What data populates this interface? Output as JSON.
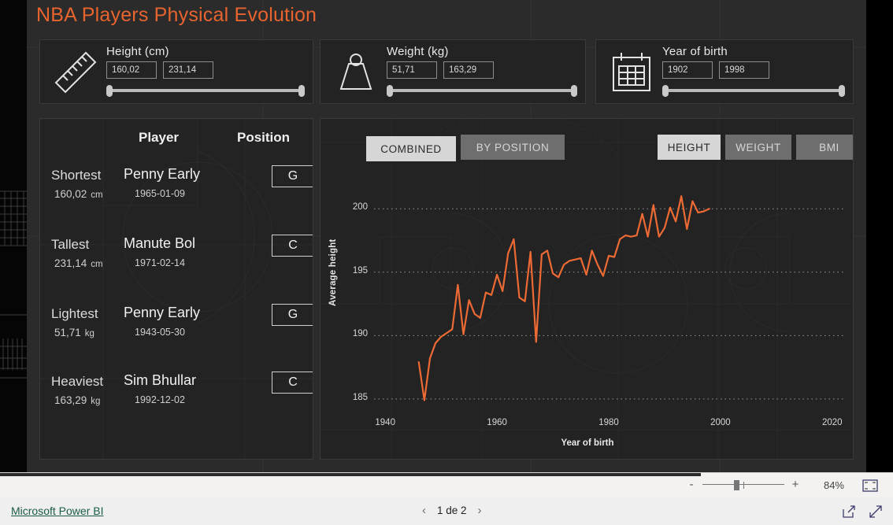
{
  "report": {
    "title": "NBA Players Physical Evolution",
    "accent_color": "#E8642E",
    "panel_bg": "#232323",
    "canvas_bg": "#2b2b2b"
  },
  "filters": [
    {
      "id": "height",
      "icon": "ruler-icon",
      "title": "Height (cm)",
      "min_value": "160,02",
      "max_value": "231,14"
    },
    {
      "id": "weight",
      "icon": "weight-icon",
      "title": "Weight (kg)",
      "min_value": "51,71",
      "max_value": "163,29"
    },
    {
      "id": "year",
      "icon": "calendar-icon",
      "title": "Year of birth",
      "min_value": "1902",
      "max_value": "1998"
    }
  ],
  "records": {
    "header_player": "Player",
    "header_position": "Position",
    "rows": [
      {
        "label": "Shortest",
        "value": "160,02",
        "unit": "cm",
        "name": "Penny Early",
        "date": "1965-01-09",
        "position": "G"
      },
      {
        "label": "Tallest",
        "value": "231,14",
        "unit": "cm",
        "name": "Manute Bol",
        "date": "1971-02-14",
        "position": "C"
      },
      {
        "label": "Lightest",
        "value": "51,71",
        "unit": "kg",
        "name": "Penny Early",
        "date": "1943-05-30",
        "position": "G"
      },
      {
        "label": "Heaviest",
        "value": "163,29",
        "unit": "kg",
        "name": "Sim Bhullar",
        "date": "1992-12-02",
        "position": "C"
      }
    ]
  },
  "chart_toolbar": {
    "mode_buttons": [
      {
        "label": "COMBINED",
        "active": true
      },
      {
        "label": "BY POSITION",
        "active": false
      }
    ],
    "metric_buttons": [
      {
        "label": "HEIGHT",
        "active": true
      },
      {
        "label": "WEIGHT",
        "active": false
      },
      {
        "label": "BMI",
        "active": false
      }
    ]
  },
  "chart_data": {
    "type": "line",
    "title": "",
    "xlabel": "Year of birth",
    "ylabel": "Average height",
    "xlim": [
      1938,
      2022
    ],
    "ylim": [
      183.5,
      202.5
    ],
    "xticks": [
      1940,
      1960,
      1980,
      2000,
      2020
    ],
    "yticks": [
      185,
      190,
      195,
      200
    ],
    "grid": "dotted-horizontal",
    "legend": "none",
    "line_color": "#ED6A35",
    "series": [
      {
        "name": "Average height",
        "x": [
          1946,
          1947,
          1948,
          1949,
          1950,
          1951,
          1952,
          1953,
          1954,
          1955,
          1956,
          1957,
          1958,
          1959,
          1960,
          1961,
          1962,
          1963,
          1964,
          1965,
          1966,
          1967,
          1968,
          1969,
          1970,
          1971,
          1972,
          1973,
          1974,
          1975,
          1976,
          1977,
          1978,
          1979,
          1980,
          1981,
          1982,
          1983,
          1984,
          1985,
          1986,
          1987,
          1988,
          1989,
          1990,
          1991,
          1992,
          1993,
          1994,
          1995,
          1996,
          1997,
          1998
        ],
        "y": [
          187.9,
          184.9,
          188.2,
          189.4,
          189.9,
          190.2,
          190.5,
          194.0,
          190.1,
          192.8,
          191.7,
          191.4,
          193.4,
          193.2,
          194.8,
          193.5,
          196.5,
          197.6,
          193.0,
          192.7,
          196.6,
          189.5,
          196.4,
          196.7,
          194.9,
          194.6,
          195.6,
          195.9,
          196.0,
          196.1,
          194.8,
          196.7,
          195.6,
          194.7,
          196.3,
          196.2,
          197.6,
          197.9,
          197.8,
          197.9,
          199.6,
          197.8,
          200.3,
          197.8,
          198.5,
          200.1,
          199.0,
          201.0,
          198.4,
          200.6,
          199.7,
          199.8,
          200.0
        ]
      }
    ]
  },
  "statusbar": {
    "zoom_minus": "-",
    "zoom_plus": "+",
    "zoom_percent": "84%",
    "fit_icon": "fit-to-page-icon"
  },
  "footer": {
    "brand_link": "Microsoft Power BI",
    "prev_icon": "chevron-left-icon",
    "next_icon": "chevron-right-icon",
    "page_indicator": "1 de 2",
    "share_icon": "share-icon",
    "expand_icon": "fullscreen-icon"
  }
}
